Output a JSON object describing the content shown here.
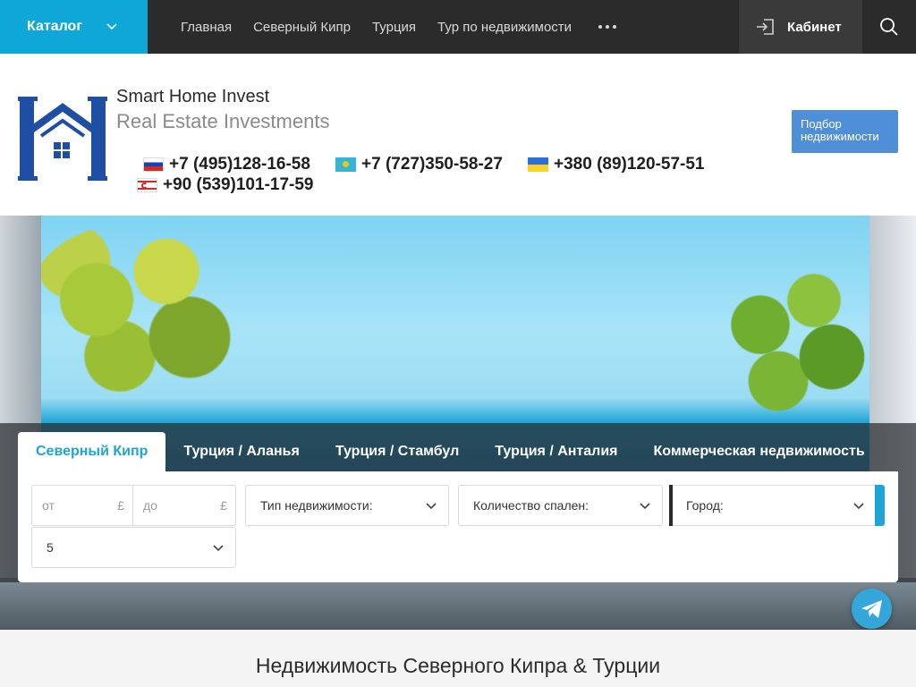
{
  "topbar": {
    "catalog_label": "Каталог",
    "nav": [
      "Главная",
      "Северный Кипр",
      "Турция",
      "Тур по недвижимости"
    ],
    "cabinet_label": "Кабинет"
  },
  "header": {
    "brand_name": "Smart Home Invest",
    "brand_sub": "Real Estate Investments",
    "phones": [
      {
        "flag": "ru",
        "number": "+7 (495)128-16-58"
      },
      {
        "flag": "kz",
        "number": "+7 (727)350-58-27"
      },
      {
        "flag": "ua",
        "number": "+380 (89)120-57-51"
      },
      {
        "flag": "trnc",
        "number": "+90 (539)101-17-59"
      }
    ],
    "pick_button": "Подбор недвижимости"
  },
  "search": {
    "tabs": [
      "Северный Кипр",
      "Турция / Аланья",
      "Турция / Стамбул",
      "Турция / Анталия",
      "Коммерческая недвижимость"
    ],
    "active_tab": 0,
    "price_from_placeholder": "от",
    "price_to_placeholder": "до",
    "currency": "£",
    "property_type": "Тип недвижимости:",
    "bedrooms": "Количество спален:",
    "city": "Город:",
    "extra_select_value": "5"
  },
  "main": {
    "heading": "Недвижимость Северного Кипра & Турции"
  },
  "colors": {
    "accent": "#0fa7d7",
    "topbar": "#2b2b2b",
    "button": "#4f8fd8"
  }
}
